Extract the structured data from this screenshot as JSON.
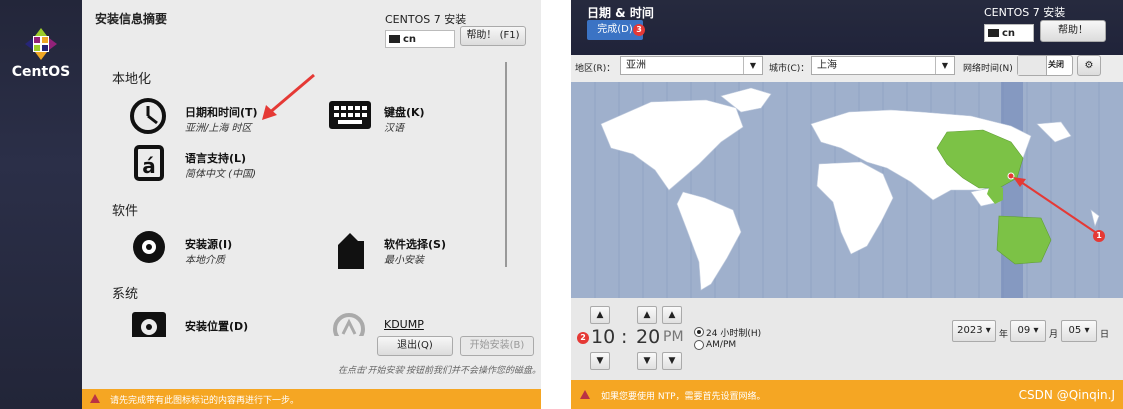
{
  "left": {
    "logo_text": "CentOS",
    "header_title": "安装信息摘要",
    "header_product": "CENTOS 7 安装",
    "keyboard_layout": "cn",
    "help_button": "帮助！ (F1)",
    "sections": {
      "localization": "本地化",
      "software": "软件",
      "system": "系统"
    },
    "items": {
      "datetime": {
        "title": "日期和时间(T)",
        "sub": "亚洲/上海 时区",
        "icon": "clock-icon"
      },
      "keyboard": {
        "title": "键盘(K)",
        "sub": "汉语",
        "icon": "keyboard-icon"
      },
      "language": {
        "title": "语言支持(L)",
        "sub": "简体中文 (中国)",
        "icon": "language-icon"
      },
      "source": {
        "title": "安装源(I)",
        "sub": "本地介质",
        "icon": "disc-icon"
      },
      "software_sel": {
        "title": "软件选择(S)",
        "sub": "最小安装",
        "icon": "package-icon"
      },
      "target": {
        "title": "安装位置(D)",
        "icon": "disk-icon"
      },
      "kdump": {
        "title": "KDUMP",
        "icon": "kdump-icon"
      }
    },
    "quit_button": "退出(Q)",
    "begin_button": "开始安装(B)",
    "footer_note": "在点击'开始安装'按钮前我们并不会操作您的磁盘。",
    "warning": "请先完成带有此图标标记的内容再进行下一步。",
    "accent_color": "#f5a623"
  },
  "right": {
    "title": "日期 & 时间",
    "product": "CENTOS 7 安装",
    "keyboard_layout": "cn",
    "help_button": "帮助！",
    "done_button": "完成(D)",
    "done_badge": "3",
    "region_label": "地区(R)：",
    "region_value": "亚洲",
    "city_label": "城市(C)：",
    "city_value": "上海",
    "ntp_label": "网络时间(N)",
    "ntp_state": "关闭",
    "map_badge": "1",
    "time_badge": "2",
    "hour": "10",
    "sep": ":",
    "minute": "20",
    "ampm": "PM",
    "format_24": "24 小时制(H)",
    "format_ampm": "AM/PM",
    "year": "2023",
    "year_label": "年",
    "month": "09",
    "month_label": "月",
    "day": "05",
    "day_label": "日",
    "warning": "如果您要使用 NTP，需要首先设置网络。",
    "watermark": "CSDN @Qinqin.J"
  }
}
